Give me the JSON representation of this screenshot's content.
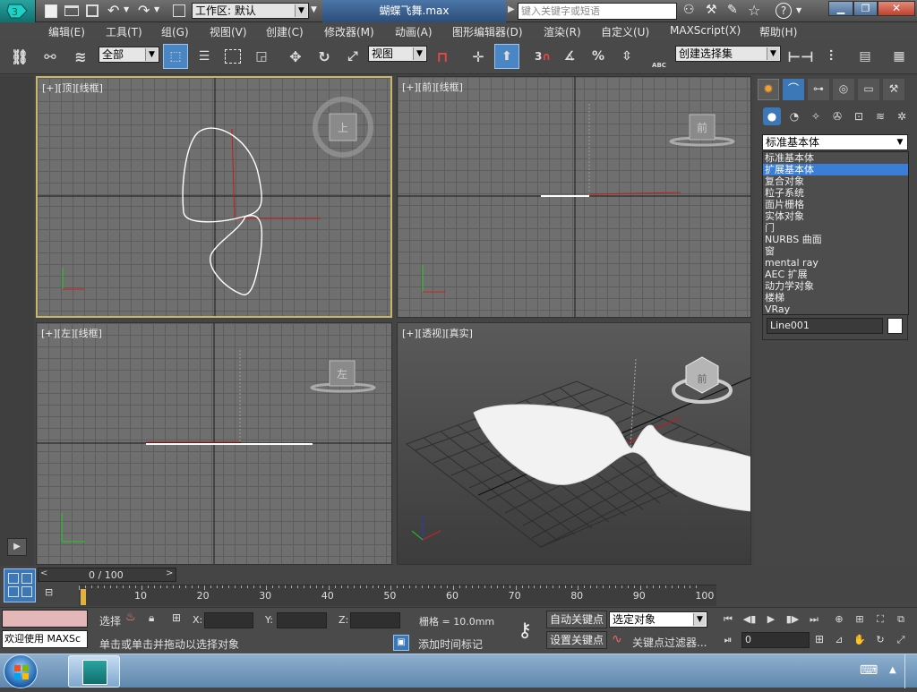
{
  "title": {
    "workspace_label": "工作区: 默认",
    "filename": "蝴蝶飞舞.max",
    "search_placeholder": "键入关键字或短语"
  },
  "menu": [
    "编辑(E)",
    "工具(T)",
    "组(G)",
    "视图(V)",
    "创建(C)",
    "修改器(M)",
    "动画(A)",
    "图形编辑器(D)",
    "渲染(R)",
    "自定义(U)",
    "MAXScript(X)",
    "帮助(H)"
  ],
  "toolbar": {
    "selection_filter": "全部",
    "ref_coord": "视图",
    "snap_angle_label": "3",
    "percent_label": "%",
    "abc_label": "ABC",
    "named_selection_placeholder": "创建选择集"
  },
  "viewports": {
    "top": {
      "label": "[+][顶][线框]",
      "cube": "上"
    },
    "front": {
      "label": "[+][前][线框]",
      "cube": "前"
    },
    "left": {
      "label": "[+][左][线框]",
      "cube": "左"
    },
    "persp": {
      "label": "[+][透视][真实]",
      "cube": "前"
    }
  },
  "command_panel": {
    "category_selected": "标准基本体",
    "dropdown_items": [
      "标准基本体",
      "扩展基本体",
      "复合对象",
      "粒子系统",
      "面片栅格",
      "实体对象",
      "门",
      "NURBS 曲面",
      "窗",
      "mental ray",
      "AEC 扩展",
      "动力学对象",
      "楼梯",
      "VRay"
    ],
    "highlighted_index": 1,
    "object_name": "Line001"
  },
  "timeline": {
    "frame_display": "0 / 100",
    "ticks": [
      "10",
      "20",
      "30",
      "40",
      "50",
      "60",
      "70",
      "80",
      "90",
      "100"
    ]
  },
  "status": {
    "maxscript_welcome": "欢迎使用 MAXSc",
    "select_label": "选择",
    "x_label": "X:",
    "y_label": "Y:",
    "z_label": "Z:",
    "grid_text": "栅格 = 10.0mm",
    "prompt": "单击或单击并拖动以选择对象",
    "add_time_tag": "添加时间标记",
    "auto_key": "自动关键点",
    "set_key": "设置关键点",
    "key_mode_value": "选定对象",
    "key_filters": "关键点过滤器...",
    "current_frame": "0"
  },
  "colors": {
    "accent": "#4b86c4",
    "active_viewport_border": "#c8b66b",
    "dropdown_highlight": "#3a7ed8"
  }
}
